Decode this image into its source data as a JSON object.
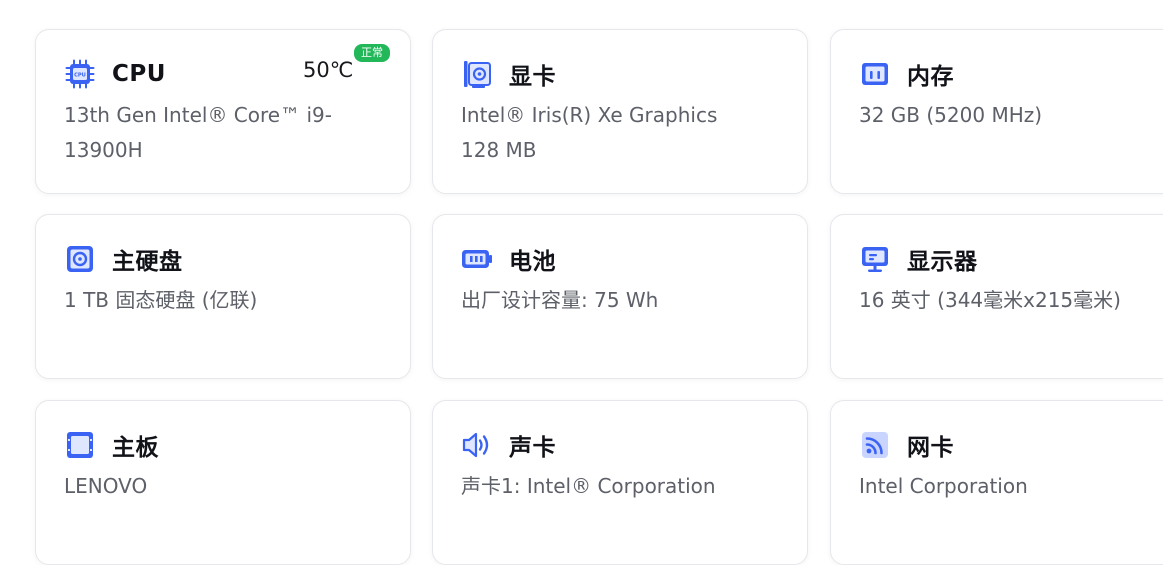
{
  "colors": {
    "accent": "#3b63f3",
    "badge_green": "#22b85a"
  },
  "cards": [
    {
      "title": "CPU",
      "icon": "cpu-icon",
      "value": "13th Gen Intel® Core™ i9-13900H",
      "temperature": "50℃",
      "status": "正常"
    },
    {
      "title": "显卡",
      "icon": "gpu-icon",
      "value": "Intel® Iris(R) Xe Graphics 128 MB"
    },
    {
      "title": "内存",
      "icon": "memory-icon",
      "value": "32 GB (5200 MHz)"
    },
    {
      "title": "主硬盘",
      "icon": "disk-icon",
      "value": "1 TB 固态硬盘 (亿联)"
    },
    {
      "title": "电池",
      "icon": "battery-icon",
      "value": "出厂设计容量: 75 Wh"
    },
    {
      "title": "显示器",
      "icon": "monitor-icon",
      "value": "16 英寸 (344毫米x215毫米)"
    },
    {
      "title": "主板",
      "icon": "motherboard-icon",
      "value": "LENOVO"
    },
    {
      "title": "声卡",
      "icon": "speaker-icon",
      "value": "声卡1: Intel® Corporation"
    },
    {
      "title": "网卡",
      "icon": "network-icon",
      "value": "Intel Corporation"
    }
  ]
}
